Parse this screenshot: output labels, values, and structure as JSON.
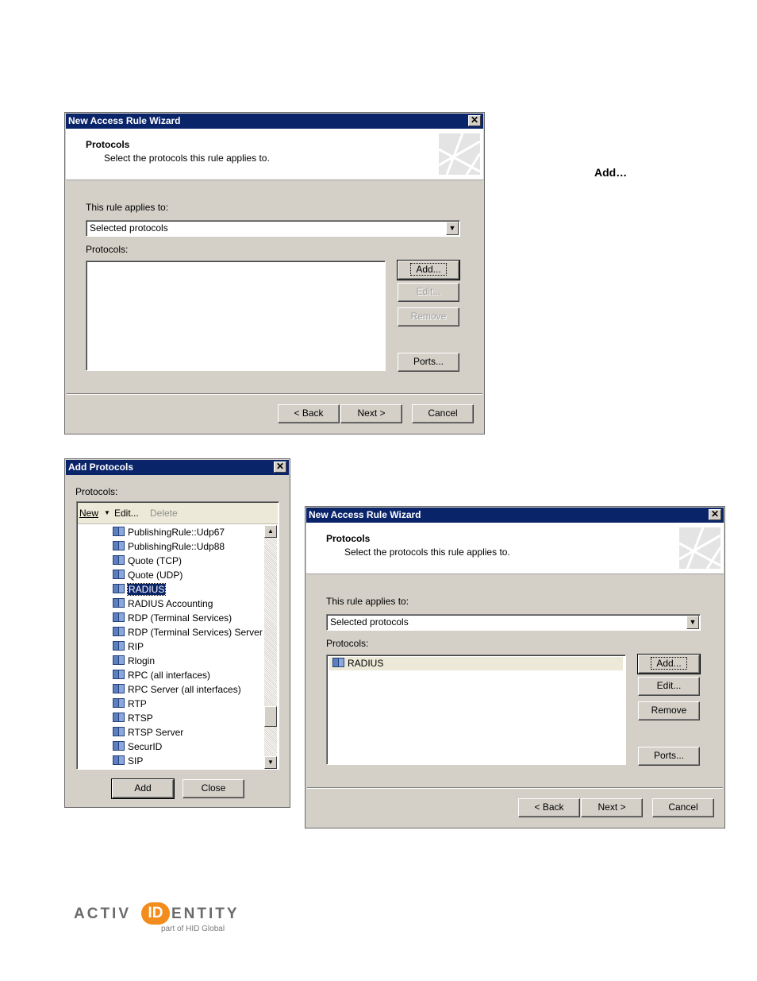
{
  "note_label": "Add…",
  "wizard1": {
    "title": "New Access Rule Wizard",
    "header_title": "Protocols",
    "header_subtitle": "Select the protocols this rule applies to.",
    "applies_label": "This rule applies to:",
    "applies_value": "Selected protocols",
    "protocols_label": "Protocols:",
    "protocols": [],
    "buttons": {
      "add": "Add...",
      "edit": "Edit...",
      "remove": "Remove",
      "ports": "Ports...",
      "back": "< Back",
      "next": "Next >",
      "cancel": "Cancel"
    }
  },
  "add_protocols": {
    "title": "Add Protocols",
    "protocols_label": "Protocols:",
    "toolbar": {
      "new": "New",
      "edit": "Edit...",
      "delete": "Delete"
    },
    "items": [
      "PublishingRule::Udp67",
      "PublishingRule::Udp88",
      "Quote (TCP)",
      "Quote (UDP)",
      "RADIUS",
      "RADIUS Accounting",
      "RDP (Terminal Services)",
      "RDP (Terminal Services) Server",
      "RIP",
      "Rlogin",
      "RPC (all interfaces)",
      "RPC Server (all interfaces)",
      "RTP",
      "RTSP",
      "RTSP Server",
      "SecurID",
      "SIP"
    ],
    "selected": "RADIUS",
    "buttons": {
      "add": "Add",
      "close": "Close"
    }
  },
  "wizard2": {
    "title": "New Access Rule Wizard",
    "header_title": "Protocols",
    "header_subtitle": "Select the protocols this rule applies to.",
    "applies_label": "This rule applies to:",
    "applies_value": "Selected protocols",
    "protocols_label": "Protocols:",
    "protocols": [
      "RADIUS"
    ],
    "buttons": {
      "add": "Add...",
      "edit": "Edit...",
      "remove": "Remove",
      "ports": "Ports...",
      "back": "< Back",
      "next": "Next >",
      "cancel": "Cancel"
    }
  },
  "footer": {
    "logo_prefix": "ACTIV",
    "logo_badge": "ID",
    "logo_suffix": "ENTITY",
    "logo_tagline": "part of HID Global"
  }
}
